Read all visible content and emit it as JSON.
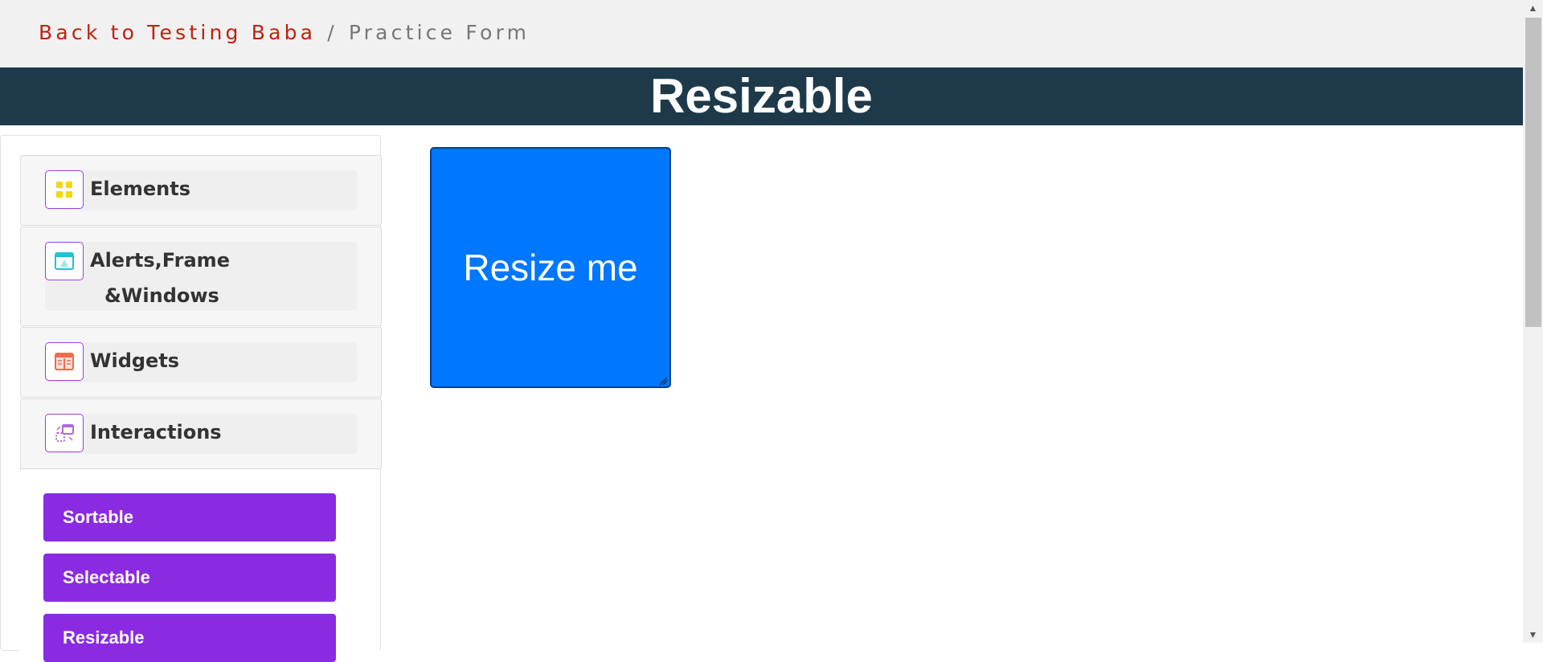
{
  "breadcrumb": {
    "back_label": "Back to Testing Baba",
    "separator": "/",
    "current": "Practice Form"
  },
  "page": {
    "title": "Resizable"
  },
  "sidebar": {
    "groups": [
      {
        "label": "Elements",
        "icon": "elements-grid-icon",
        "icon_color": "#f5d90a"
      },
      {
        "label_line1": "Alerts,Frame",
        "label_line2": "&Windows",
        "icon": "browser-window-icon",
        "icon_color": "#1ec3d4"
      },
      {
        "label": "Widgets",
        "icon": "widgets-panel-icon",
        "icon_color": "#f06a4e"
      },
      {
        "label": "Interactions",
        "icon": "interactions-icon",
        "icon_color": "#b06ad8"
      }
    ],
    "interaction_items": [
      {
        "label": "Sortable"
      },
      {
        "label": "Selectable"
      },
      {
        "label": "Resizable"
      }
    ]
  },
  "resizable_box": {
    "label": "Resize me",
    "color": "#0077ff"
  },
  "colors": {
    "back_link": "#c0200f",
    "title_bar": "#1e3a4a",
    "submenu_button": "#8a2be2"
  }
}
